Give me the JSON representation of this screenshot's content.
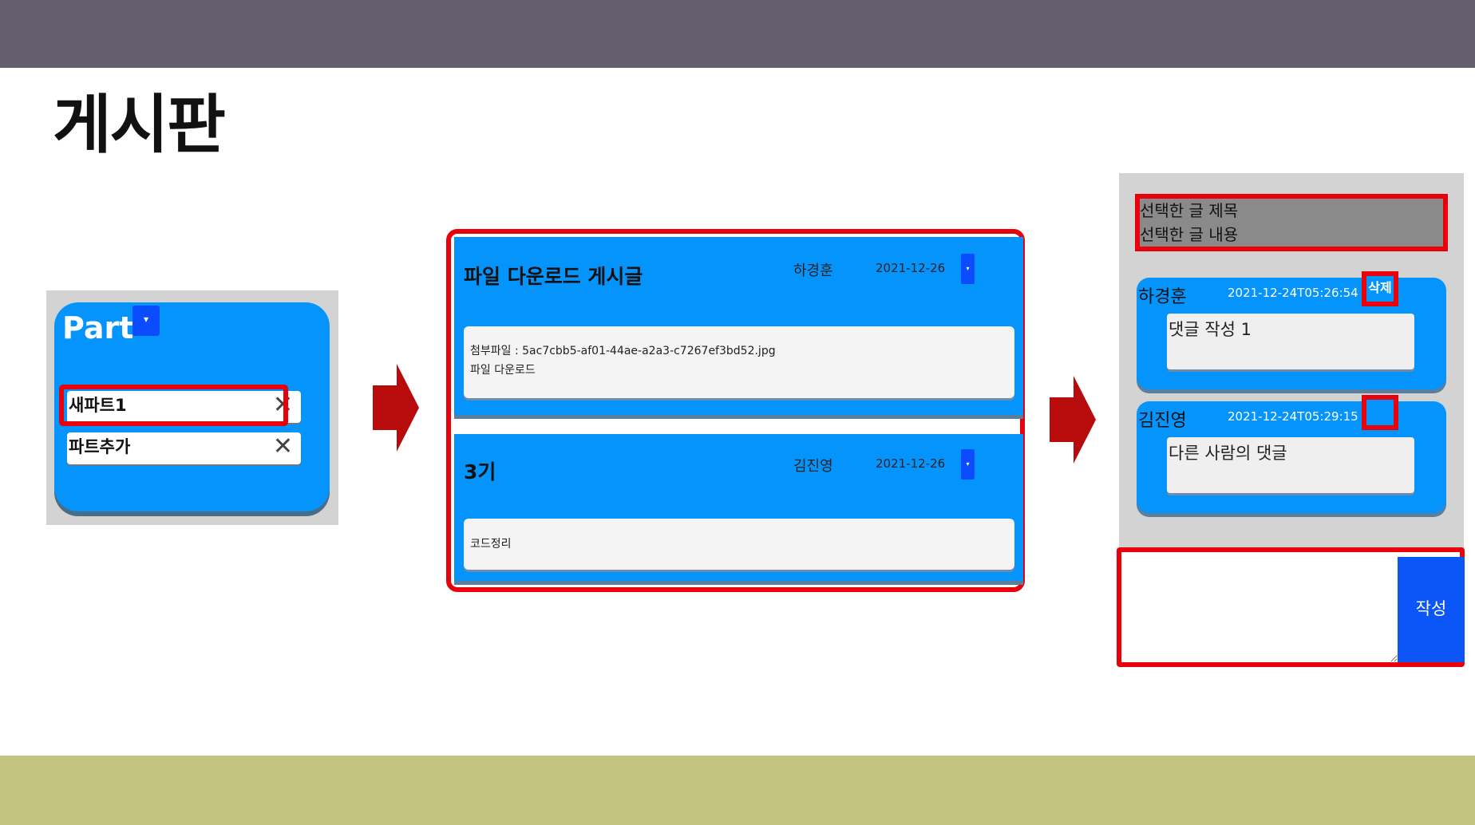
{
  "slide": {
    "title": "게시판"
  },
  "part_panel": {
    "title": "Part",
    "dropdown_glyph": "▾",
    "items": [
      {
        "label": "새파트1",
        "remove_glyph": "✕"
      },
      {
        "label": "파트추가",
        "remove_glyph": "✕"
      }
    ]
  },
  "posts": [
    {
      "title": "파일 다운로드 게시글",
      "author": "하경훈",
      "date": "2021-12-26",
      "dropdown_glyph": "▾",
      "body_lines": [
        "첨부파일 : 5ac7cbb5-af01-44ae-a2a3-c7267ef3bd52.jpg",
        "파일 다운로드"
      ]
    },
    {
      "title": "3기",
      "author": "김진영",
      "date": "2021-12-26",
      "dropdown_glyph": "▾",
      "body_lines": [
        "코드정리"
      ]
    }
  ],
  "detail": {
    "selected_title": "선택한 글 제목",
    "selected_content": "선택한 글 내용",
    "comments": [
      {
        "author": "하경훈",
        "timestamp": "2021-12-24T05:26:54",
        "delete_label": "삭제",
        "text": "댓글 작성 1"
      },
      {
        "author": "김진영",
        "timestamp": "2021-12-24T05:29:15",
        "delete_label": "",
        "text": "다른 사람의 댓글"
      }
    ],
    "write_button": "작성"
  },
  "colors": {
    "top_bar": "#655e6d",
    "bottom_bar": "#c3c47f",
    "panel_blue": "#0494fc",
    "button_blue": "#0c4cff",
    "highlight_red": "#e8000b",
    "arrow_red": "#b80c0c"
  },
  "icons": {
    "arrow": "arrow-right-icon",
    "remove": "close-icon",
    "dropdown": "caret-down-icon"
  }
}
